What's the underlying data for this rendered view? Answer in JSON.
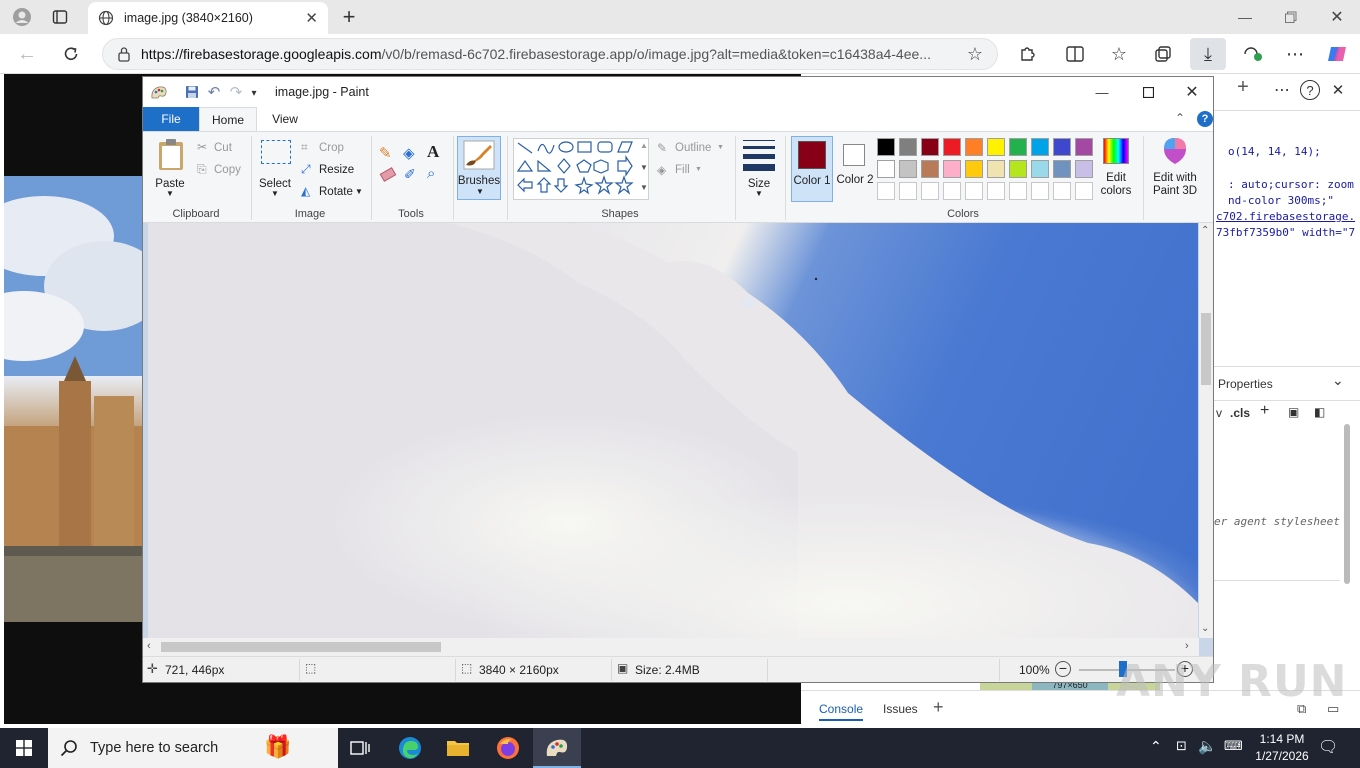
{
  "browser": {
    "tab_title": "image.jpg (3840×2160)",
    "url_host": "https://firebasestorage.googleapis.com",
    "url_rest": "/v0/b/remasd-6c702.firebasestorage.app/o/image.jpg?alt=media&token=c16438a4-4ee..."
  },
  "devtools": {
    "lines": [
      "o(14, 14, 14);",
      ": auto;cursor: zoom",
      "nd-color 300ms;\"",
      "c702.firebasestorage.",
      "73fbf7359b0\" width=\"7"
    ],
    "properties_label": "Properties",
    "cls_label": ".cls",
    "v_label": "v",
    "ua_stylesheet": "er agent stylesheet",
    "dim_badge": "797×650",
    "console_tab": "Console",
    "issues_tab": "Issues"
  },
  "paint": {
    "title": "image.jpg - Paint",
    "tabs": {
      "file": "File",
      "home": "Home",
      "view": "View"
    },
    "clipboard": {
      "paste": "Paste",
      "cut": "Cut",
      "copy": "Copy",
      "label": "Clipboard"
    },
    "image": {
      "select": "Select",
      "crop": "Crop",
      "resize": "Resize",
      "rotate": "Rotate",
      "label": "Image"
    },
    "tools": {
      "label": "Tools"
    },
    "brushes": {
      "label": "Brushes"
    },
    "shapes": {
      "outline": "Outline",
      "fill": "Fill",
      "label": "Shapes"
    },
    "size": {
      "label": "Size"
    },
    "colors": {
      "color1": "Color 1",
      "color2": "Color 2",
      "edit": "Edit colors",
      "label": "Colors",
      "color1_value": "#880015",
      "color2_value": "#ffffff",
      "palette_row1": [
        "#000000",
        "#7f7f7f",
        "#880015",
        "#ed1c24",
        "#ff7f27",
        "#fff200",
        "#22b14c",
        "#00a2e8",
        "#3f48cc",
        "#a349a4"
      ],
      "palette_row2": [
        "#ffffff",
        "#c3c3c3",
        "#b97a57",
        "#ffaec9",
        "#ffc90e",
        "#efe4b0",
        "#b5e61d",
        "#99d9ea",
        "#7092be",
        "#c8bfe7"
      ]
    },
    "paint3d": "Edit with Paint 3D",
    "status": {
      "cursor": "721, 446px",
      "dimensions": "3840 × 2160px",
      "size": "Size: 2.4MB",
      "zoom": "100%"
    }
  },
  "taskbar": {
    "search_placeholder": "Type here to search",
    "time": "1:14 PM",
    "date": "1/27/2026"
  },
  "watermark": "ANY RUN"
}
